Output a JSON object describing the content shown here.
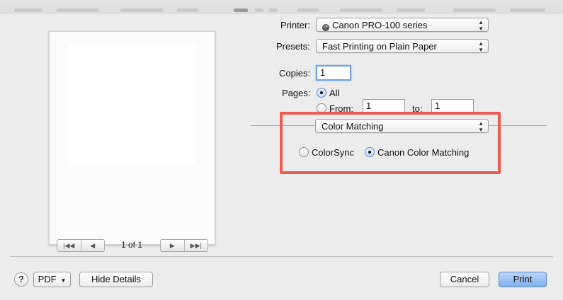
{
  "preview": {
    "page_count": "1 of 1",
    "nav_first_icon": "first-page-icon",
    "nav_prev_icon": "previous-page-icon",
    "nav_next_icon": "next-page-icon",
    "nav_last_icon": "last-page-icon"
  },
  "printer": {
    "label": "Printer:",
    "value": "Canon PRO-100 series",
    "icon": "printer-status-icon"
  },
  "presets": {
    "label": "Presets:",
    "value": "Fast Printing on Plain Paper"
  },
  "copies": {
    "label": "Copies:",
    "value": "1"
  },
  "pages": {
    "label": "Pages:",
    "all_label": "All",
    "from_label": "From:",
    "from_value": "1",
    "to_label": "to:",
    "to_value": "1",
    "selected": "All"
  },
  "section": {
    "value": "Color Matching"
  },
  "color_matching": {
    "colorsync_label": "ColorSync",
    "canon_label": "Canon Color Matching",
    "selected": "Canon Color Matching"
  },
  "footer": {
    "help_label": "?",
    "pdf_label": "PDF",
    "hide_details_label": "Hide Details",
    "cancel_label": "Cancel",
    "print_label": "Print"
  },
  "colors": {
    "highlight": "#ec5b52",
    "primary_button": "#7fb0ee",
    "focus_ring": "#6fa0de"
  }
}
